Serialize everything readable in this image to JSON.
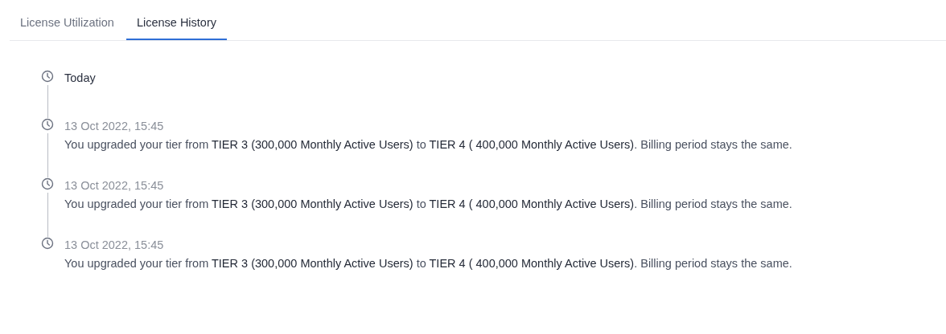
{
  "tabs": [
    {
      "label": "License Utilization",
      "selected": false
    },
    {
      "label": "License History",
      "selected": true
    }
  ],
  "timeline": [
    {
      "title": "Today",
      "kind": "heading"
    },
    {
      "title": "13 Oct 2022, 15:45",
      "kind": "event",
      "description": "You upgraded your tier from **TIER 3 (300,000 Monthly Active Users)** to **TIER 4 ( 400,000 Monthly Active Users)**. Billing period stays the same."
    },
    {
      "title": "13 Oct 2022, 15:45",
      "kind": "event",
      "description": "You upgraded your tier from **TIER 3 (300,000 Monthly Active Users)** to **TIER 4 ( 400,000 Monthly Active Users)**. Billing period stays the same."
    },
    {
      "title": "13 Oct 2022, 15:45",
      "kind": "event",
      "description": "You upgraded your tier from **TIER 3 (300,000 Monthly Active Users)** to **TIER 4 ( 400,000 Monthly Active Users)**. Billing period stays the same."
    }
  ]
}
